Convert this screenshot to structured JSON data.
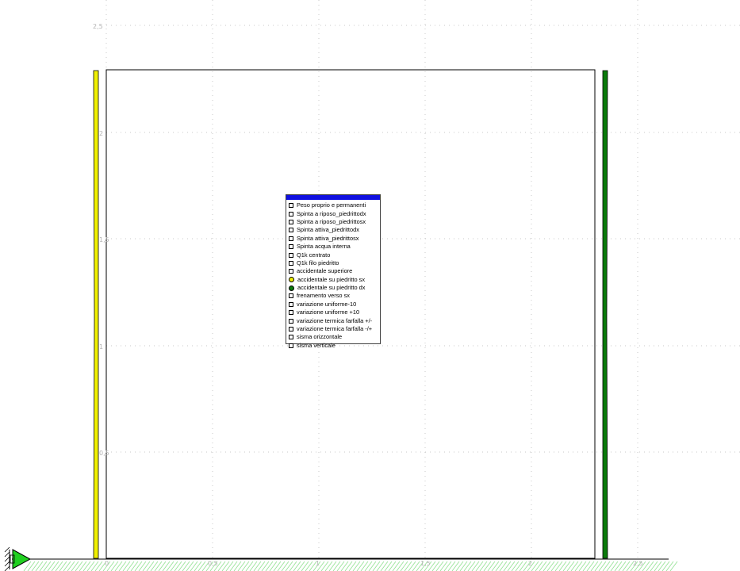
{
  "axis": {
    "y_labels": [
      "2,5",
      "2",
      "1,5",
      "1",
      "0,5"
    ],
    "x_labels": [
      "0",
      "0,5",
      "1",
      "1,5",
      "2",
      "2,5"
    ]
  },
  "colors": {
    "left_member": "#f0f000",
    "right_member": "#0a7a0a",
    "support": "#20d020",
    "ground_hatch": "#90e090",
    "grid": "#c8c8c8",
    "legend_header": "#1010e0"
  },
  "legend": {
    "items": [
      {
        "label": "Peso proprio e permanenti",
        "marker": "box"
      },
      {
        "label": "Spinta a riposo_piedrittodx",
        "marker": "box"
      },
      {
        "label": "Spinta a riposo_piedrittosx",
        "marker": "box"
      },
      {
        "label": "Spinta attiva_piedrittodx",
        "marker": "box"
      },
      {
        "label": "Spinta attiva_piedrittosx",
        "marker": "box"
      },
      {
        "label": "Spinta acqua interna",
        "marker": "box"
      },
      {
        "label": "Q1k centrato",
        "marker": "box"
      },
      {
        "label": "Q1k filo piedritto",
        "marker": "box"
      },
      {
        "label": "accidentale superiore",
        "marker": "box"
      },
      {
        "label": "accidentale su piedritto sx",
        "marker": "dot-yellow"
      },
      {
        "label": "accidentale su piedritto dx",
        "marker": "dot-green"
      },
      {
        "label": "frenamento verso sx",
        "marker": "box"
      },
      {
        "label": "variazione uniforme-10",
        "marker": "box"
      },
      {
        "label": "variazione uniforme +10",
        "marker": "box"
      },
      {
        "label": "variazione termica farfalla +/-",
        "marker": "box"
      },
      {
        "label": "variazione termica farfalla -/+",
        "marker": "box"
      },
      {
        "label": "sisma orizzontale",
        "marker": "box"
      },
      {
        "label": "sisma verticale",
        "marker": "box"
      }
    ]
  }
}
